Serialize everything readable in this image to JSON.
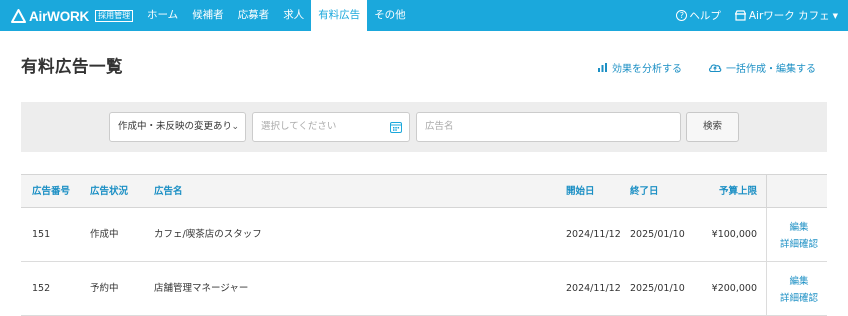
{
  "brand": {
    "logo_text": "AirWORK",
    "badge": "採用管理",
    "accent": "#1ba8dc"
  },
  "nav": {
    "items": [
      {
        "label": "ホーム",
        "active": false
      },
      {
        "label": "候補者",
        "active": false
      },
      {
        "label": "応募者",
        "active": false
      },
      {
        "label": "求人",
        "active": false
      },
      {
        "label": "有料広告",
        "active": true
      },
      {
        "label": "その他",
        "active": false
      }
    ]
  },
  "header_right": {
    "help_label": "ヘルプ",
    "account_label": "Airワーク カフェ"
  },
  "page": {
    "title": "有料広告一覧",
    "analyze_link": "効果を分析する",
    "bulk_link": "一括作成・編集する"
  },
  "search": {
    "status_value": "作成中・未反映の変更あり",
    "date_placeholder": "選択してください",
    "name_placeholder": "広告名",
    "search_button": "検索"
  },
  "table": {
    "headers": {
      "number": "広告番号",
      "status": "広告状況",
      "name": "広告名",
      "start": "開始日",
      "end": "終了日",
      "budget": "予算上限"
    },
    "rows": [
      {
        "number": "151",
        "status": "作成中",
        "name": "カフェ/喫茶店のスタッフ",
        "start": "2024/11/12",
        "end": "2025/01/10",
        "budget": "¥100,000",
        "edit": "編集",
        "detail": "詳細確認"
      },
      {
        "number": "152",
        "status": "予約中",
        "name": "店舗管理マネージャー",
        "start": "2024/11/12",
        "end": "2025/01/10",
        "budget": "¥200,000",
        "edit": "編集",
        "detail": "詳細確認"
      }
    ]
  }
}
